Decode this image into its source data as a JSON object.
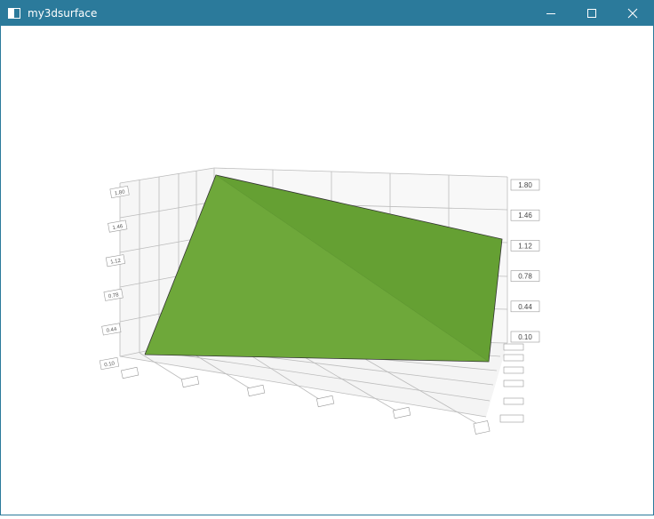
{
  "window": {
    "title": "my3dsurface",
    "controls": {
      "minimize_icon": "minimize-icon",
      "maximize_icon": "maximize-icon",
      "close_icon": "close-icon"
    },
    "titlebar_color": "#2b7a9b"
  },
  "chart_data": {
    "type": "surface",
    "surface_color": "#6ea83a",
    "z_ticks": [
      "0.10",
      "0.44",
      "0.78",
      "1.12",
      "1.46",
      "1.80"
    ],
    "z_range": [
      0.1,
      1.8
    ],
    "grid": true
  }
}
